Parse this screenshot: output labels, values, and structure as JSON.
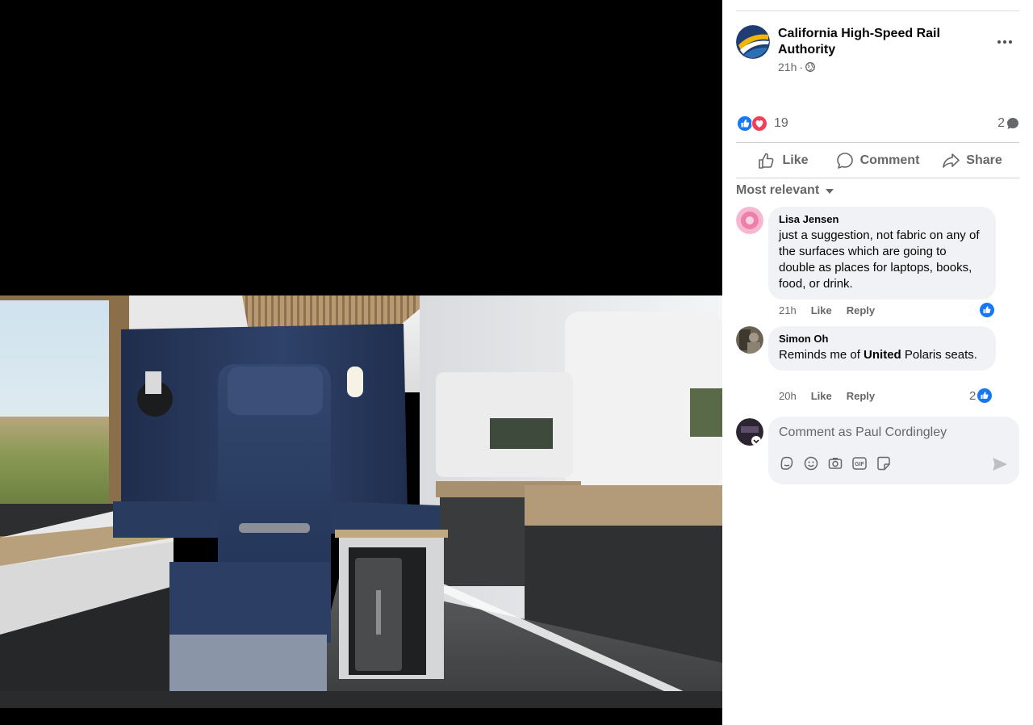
{
  "post": {
    "page_name": "California High-Speed Rail Authority",
    "time": "21h",
    "separator": "·",
    "privacy_icon": "globe-icon",
    "more_icon": "more-horizontal-icon"
  },
  "reactions": {
    "types": [
      "like",
      "love"
    ],
    "count": "19",
    "comment_count": "2"
  },
  "actions": {
    "like": "Like",
    "comment": "Comment",
    "share": "Share"
  },
  "sort": {
    "label": "Most relevant"
  },
  "comments": [
    {
      "author": "Lisa Jensen",
      "text": "just a suggestion, not fabric on any of the surfaces which are going to double as places for laptops, books, food, or drink.",
      "time": "21h",
      "like_label": "Like",
      "reply_label": "Reply",
      "reaction_count": ""
    },
    {
      "author": "Simon Oh",
      "text_before": "Reminds me of ",
      "text_bold": "United",
      "text_after": " Polaris seats.",
      "time": "20h",
      "like_label": "Like",
      "reply_label": "Reply",
      "reaction_count": "2"
    }
  ],
  "composer": {
    "placeholder": "Comment as Paul Cordingley",
    "tools": [
      "avatar-sticker-icon",
      "emoji-icon",
      "camera-icon",
      "gif-icon",
      "sticker-icon"
    ],
    "gif_label": "GIF"
  },
  "colors": {
    "facebook_blue": "#1877f2",
    "love_red": "#f33e58",
    "seat_navy": "#2a3a5c",
    "panel_bg": "#ffffff",
    "bubble_bg": "#f0f2f5",
    "secondary_text": "#65676b"
  }
}
